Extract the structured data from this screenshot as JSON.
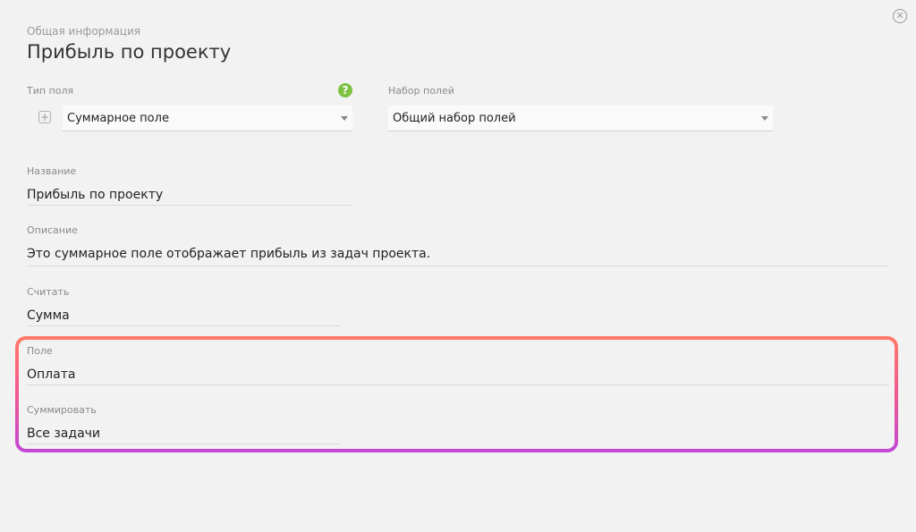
{
  "header": {
    "breadcrumb": "Общая информация",
    "title": "Прибыль по проекту",
    "close_icon": "close-circle-icon"
  },
  "field_type": {
    "label": "Тип поля",
    "value": "Суммарное поле",
    "help_glyph": "?",
    "help_color": "#7cc242"
  },
  "field_set": {
    "label": "Набор полей",
    "value": "Общий набор полей"
  },
  "name": {
    "label": "Название",
    "value": "Прибыль по проекту"
  },
  "description": {
    "label": "Описание",
    "value": "Это суммарное поле отображает прибыль из задач проекта."
  },
  "count": {
    "label": "Считать",
    "value": "Сумма"
  },
  "field": {
    "label": "Поле",
    "value": "Оплата"
  },
  "summarize": {
    "label": "Суммировать",
    "value": "Все задачи"
  },
  "highlight_colors": [
    "#ff7a6a",
    "#ee5a8f",
    "#c247d6"
  ]
}
